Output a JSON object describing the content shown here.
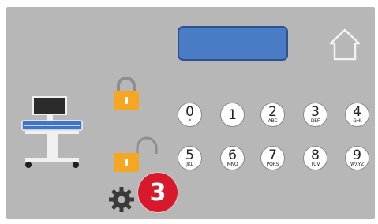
{
  "keypad": {
    "row1": [
      {
        "digit": "0",
        "letters": "*"
      },
      {
        "digit": "1",
        "letters": ""
      },
      {
        "digit": "2",
        "letters": "ABC"
      },
      {
        "digit": "3",
        "letters": "DEF"
      },
      {
        "digit": "4",
        "letters": "GHI"
      }
    ],
    "row2": [
      {
        "digit": "5",
        "letters": "JKL"
      },
      {
        "digit": "6",
        "letters": "MNO"
      },
      {
        "digit": "7",
        "letters": "PQRS"
      },
      {
        "digit": "8",
        "letters": "TUV"
      },
      {
        "digit": "9",
        "letters": "WXYZ"
      }
    ]
  },
  "badge": {
    "number": "3",
    "color": "#d8192b"
  },
  "display": {
    "text": "",
    "color": "#4a7cc6"
  },
  "icons": {
    "home": "home-icon",
    "cart": "workstation-cart-icon",
    "lock_closed": "lock-closed-icon",
    "lock_open": "lock-open-icon",
    "settings": "gear-icon"
  },
  "colors": {
    "panel": "#b7b7b7",
    "lock": "#f5a623"
  }
}
